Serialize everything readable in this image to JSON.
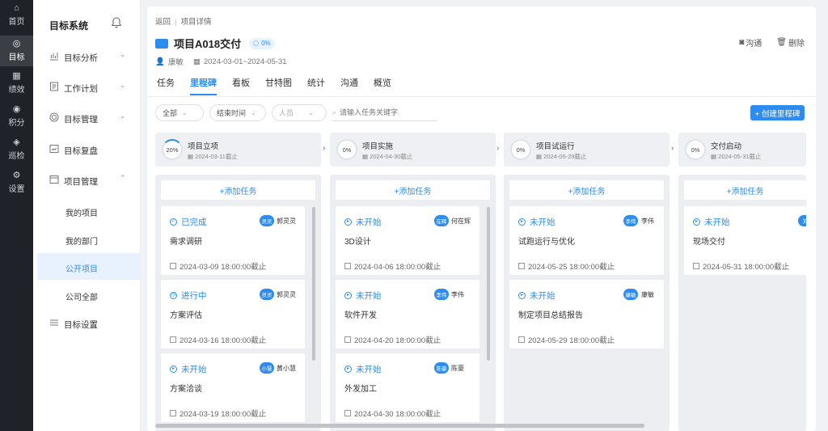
{
  "rail": {
    "items": [
      {
        "label": "首页",
        "icon": "home-icon",
        "glyph": "⌂"
      },
      {
        "label": "目标",
        "icon": "target-icon",
        "glyph": "◎"
      },
      {
        "label": "绩效",
        "icon": "chart-icon",
        "glyph": "▦"
      },
      {
        "label": "积分",
        "icon": "points-icon",
        "glyph": "◉"
      },
      {
        "label": "巡检",
        "icon": "inspect-icon",
        "glyph": "◈"
      },
      {
        "label": "设置",
        "icon": "settings-icon",
        "glyph": "⚙"
      }
    ]
  },
  "sidebar": {
    "title": "目标系统",
    "menu": [
      {
        "label": "目标分析",
        "icon": "analysis-icon",
        "arrow": "⌄"
      },
      {
        "label": "工作计划",
        "icon": "plan-icon",
        "arrow": "⌄"
      },
      {
        "label": "目标管理",
        "icon": "manage-icon",
        "arrow": "⌄"
      },
      {
        "label": "目标复盘",
        "icon": "review-icon",
        "arrow": ""
      },
      {
        "label": "项目管理",
        "icon": "project-icon",
        "arrow": "⌃"
      }
    ],
    "submenu": [
      {
        "label": "我的项目"
      },
      {
        "label": "我的部门"
      },
      {
        "label": "公开项目"
      },
      {
        "label": "公司全部"
      }
    ],
    "settings_label": "目标设置"
  },
  "breadcrumb": {
    "back": "返回",
    "current": "项目详情"
  },
  "project": {
    "name": "项目A018交付",
    "progress": "0%",
    "owner": "康敏",
    "dates": "2024-03-01~2024-05-31"
  },
  "actions": {
    "chat": "沟通",
    "delete": "删除"
  },
  "tabs": [
    "任务",
    "里程碑",
    "看板",
    "甘特图",
    "统计",
    "沟通",
    "概览"
  ],
  "filters": {
    "status": "全部",
    "sort": "结束时间",
    "person": "人员",
    "search_placeholder": "请输入任务关键字",
    "create": "+ 创建里程碑"
  },
  "milestones": [
    {
      "pct": "20%",
      "title": "项目立项",
      "date": "2024-03-11截止"
    },
    {
      "pct": "0%",
      "title": "项目实施",
      "date": "2024-04-30截止"
    },
    {
      "pct": "0%",
      "title": "项目试运行",
      "date": "2024-05-29截止"
    },
    {
      "pct": "0%",
      "title": "交付启动",
      "date": "2024-05-31截止"
    }
  ],
  "add_task_label": "+添加任务",
  "columns": [
    [
      {
        "status": "已完成",
        "avatar": "灵灵",
        "assignee": "郭灵灵",
        "task": "需求调研",
        "deadline": "2024-03-09 18:00:00截止"
      },
      {
        "status": "进行中",
        "avatar": "灵灵",
        "assignee": "郭灵灵",
        "task": "方案评估",
        "deadline": "2024-03-16 18:00:00截止"
      },
      {
        "status": "未开始",
        "avatar": "小慧",
        "assignee": "黄小慧",
        "task": "方案洽谈",
        "deadline": "2024-03-19 18:00:00截止"
      }
    ],
    [
      {
        "status": "未开始",
        "avatar": "在辉",
        "assignee": "何在辉",
        "task": "3D设计",
        "deadline": "2024-04-06 18:00:00截止"
      },
      {
        "status": "未开始",
        "avatar": "李伟",
        "assignee": "李伟",
        "task": "软件开发",
        "deadline": "2024-04-20 18:00:00截止"
      },
      {
        "status": "未开始",
        "avatar": "陈豪",
        "assignee": "陈豪",
        "task": "外发加工",
        "deadline": "2024-04-30 18:00:00截止"
      }
    ],
    [
      {
        "status": "未开始",
        "avatar": "李伟",
        "assignee": "李伟",
        "task": "试跑运行与优化",
        "deadline": "2024-05-25 18:00:00截止"
      },
      {
        "status": "未开始",
        "avatar": "康敏",
        "assignee": "康敏",
        "task": "制定项目总结报告",
        "deadline": "2024-05-29 18:00:00截止"
      }
    ],
    [
      {
        "status": "未开始",
        "avatar": "刘",
        "assignee": "",
        "task": "现场交付",
        "deadline": "2024-05-31 18:00:00截止"
      }
    ]
  ],
  "colors": {
    "accent": "#2d8cf0",
    "rail_bg": "#1f2329",
    "done": "#2d8cf0"
  }
}
